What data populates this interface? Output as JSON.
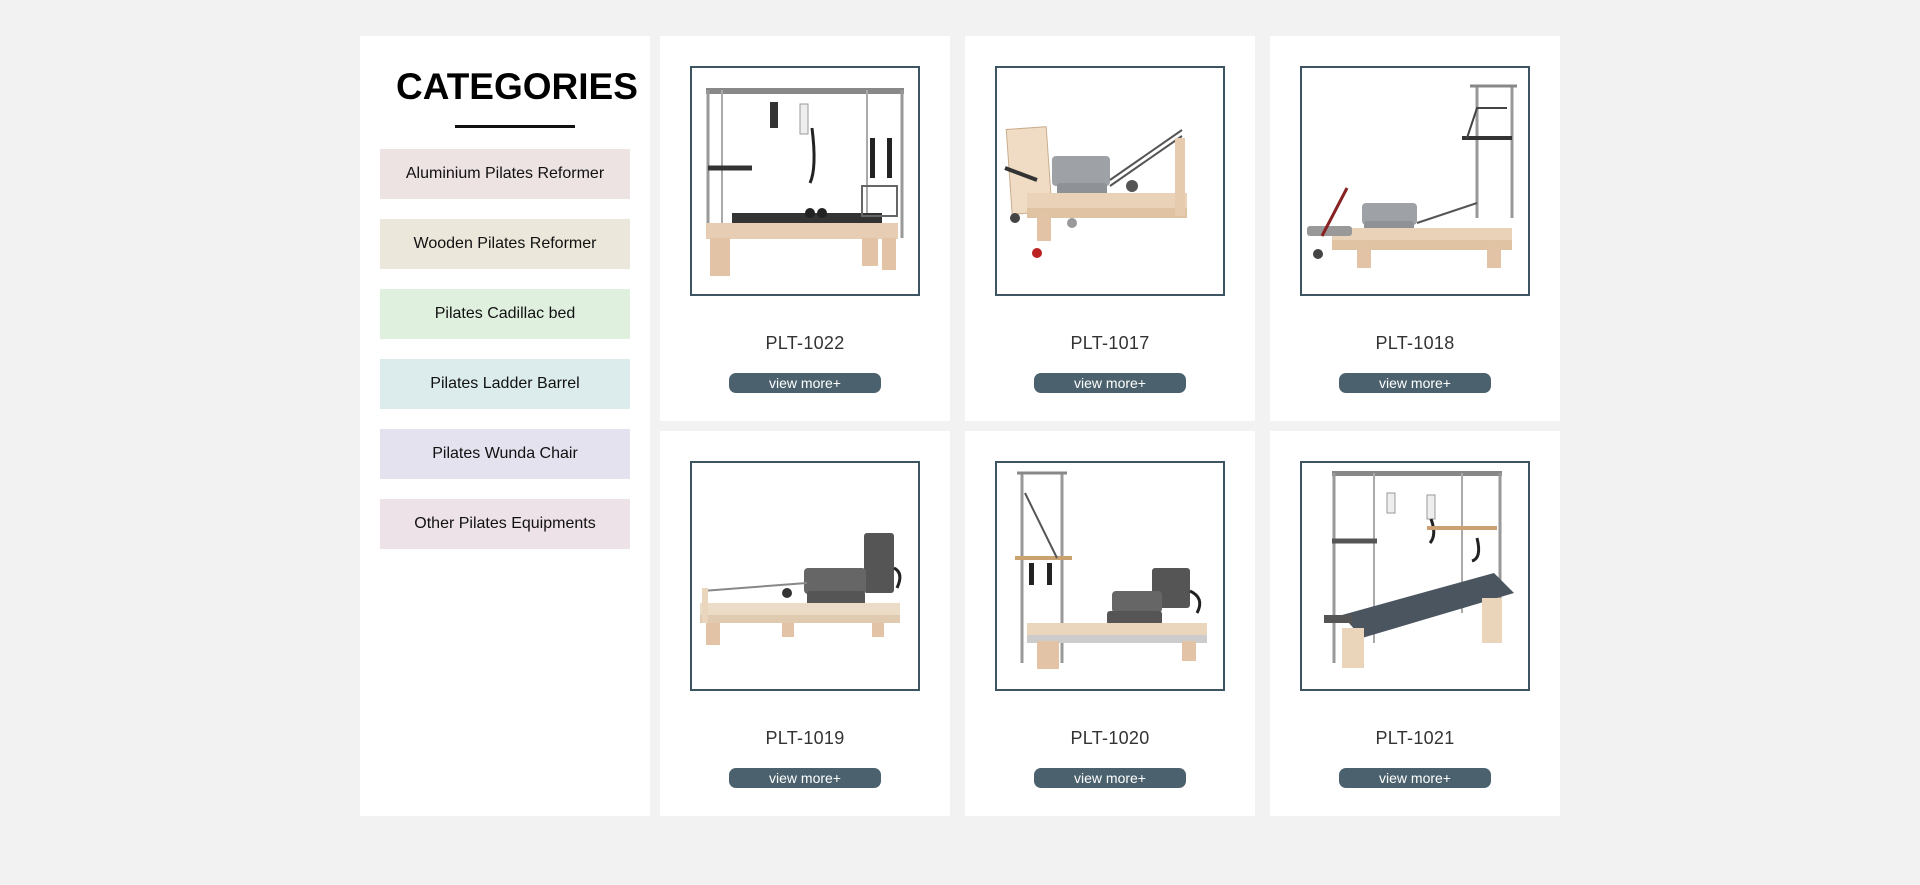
{
  "sidebar": {
    "title": "CATEGORIES",
    "items": [
      {
        "label": "Aluminium Pilates Reformer",
        "color": "#ede3e3"
      },
      {
        "label": "Wooden Pilates Reformer",
        "color": "#ebe7da"
      },
      {
        "label": "Pilates Cadillac bed",
        "color": "#dff0df"
      },
      {
        "label": "Pilates Ladder Barrel",
        "color": "#dcecec"
      },
      {
        "label": "Pilates Wunda Chair",
        "color": "#e4e2ef"
      },
      {
        "label": "Other Pilates Equipments",
        "color": "#ece2e7"
      }
    ]
  },
  "products": [
    {
      "code": "PLT-1022",
      "button": "view more+"
    },
    {
      "code": "PLT-1017",
      "button": "view more+"
    },
    {
      "code": "PLT-1018",
      "button": "view more+"
    },
    {
      "code": "PLT-1019",
      "button": "view more+"
    },
    {
      "code": "PLT-1020",
      "button": "view more+"
    },
    {
      "code": "PLT-1021",
      "button": "view more+"
    }
  ],
  "colors": {
    "background": "#f2f2f2",
    "frame_border": "#3d5563",
    "button_bg": "#4b626e"
  }
}
